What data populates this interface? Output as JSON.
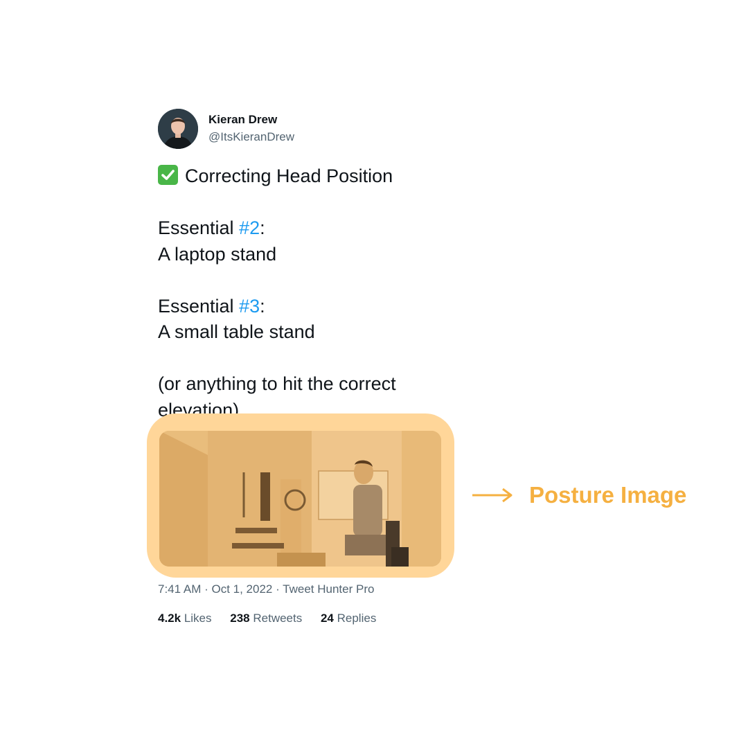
{
  "tweet": {
    "author_name": "Kieran Drew",
    "author_handle": "@ItsKieranDrew",
    "line1": "Correcting Head Position",
    "essential2_prefix": "Essential ",
    "essential2_tag": "#2",
    "essential2_suffix": ":",
    "essential2_item": "A laptop stand",
    "essential3_prefix": "Essential ",
    "essential3_tag": "#3",
    "essential3_suffix": ":",
    "essential3_item": "A small table stand",
    "note_line1": "(or anything to hit the correct",
    "note_line2": "elevation)",
    "meta": "7:41 AM · Oct 1, 2022 · Tweet Hunter Pro",
    "likes_count": "4.2k",
    "likes_label": "Likes",
    "retweets_count": "238",
    "retweets_label": "Retweets",
    "replies_count": "24",
    "replies_label": "Replies"
  },
  "callout": {
    "label": "Posture Image"
  },
  "colors": {
    "highlight": "#ffd699",
    "callout": "#f5b041",
    "hashtag": "#1d9bf0",
    "check": "#49b648"
  },
  "icons": {
    "check": "check-mark-button-icon",
    "arrow": "arrow-right-icon"
  }
}
